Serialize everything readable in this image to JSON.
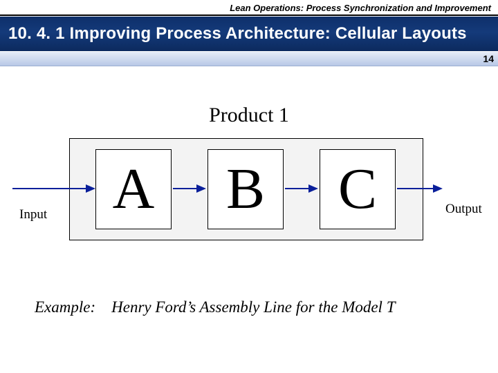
{
  "header": {
    "course": "Lean Operations: Process Synchronization and Improvement"
  },
  "title": "10. 4. 1  Improving Process Architecture: Cellular Layouts",
  "page_number": "14",
  "diagram": {
    "product_label": "Product 1",
    "input_label": "Input",
    "output_label": "Output",
    "stations": {
      "a": "A",
      "b": "B",
      "c": "C"
    }
  },
  "example": {
    "lead": "Example:",
    "text": "Henry Ford’s Assembly Line for the Model T"
  }
}
